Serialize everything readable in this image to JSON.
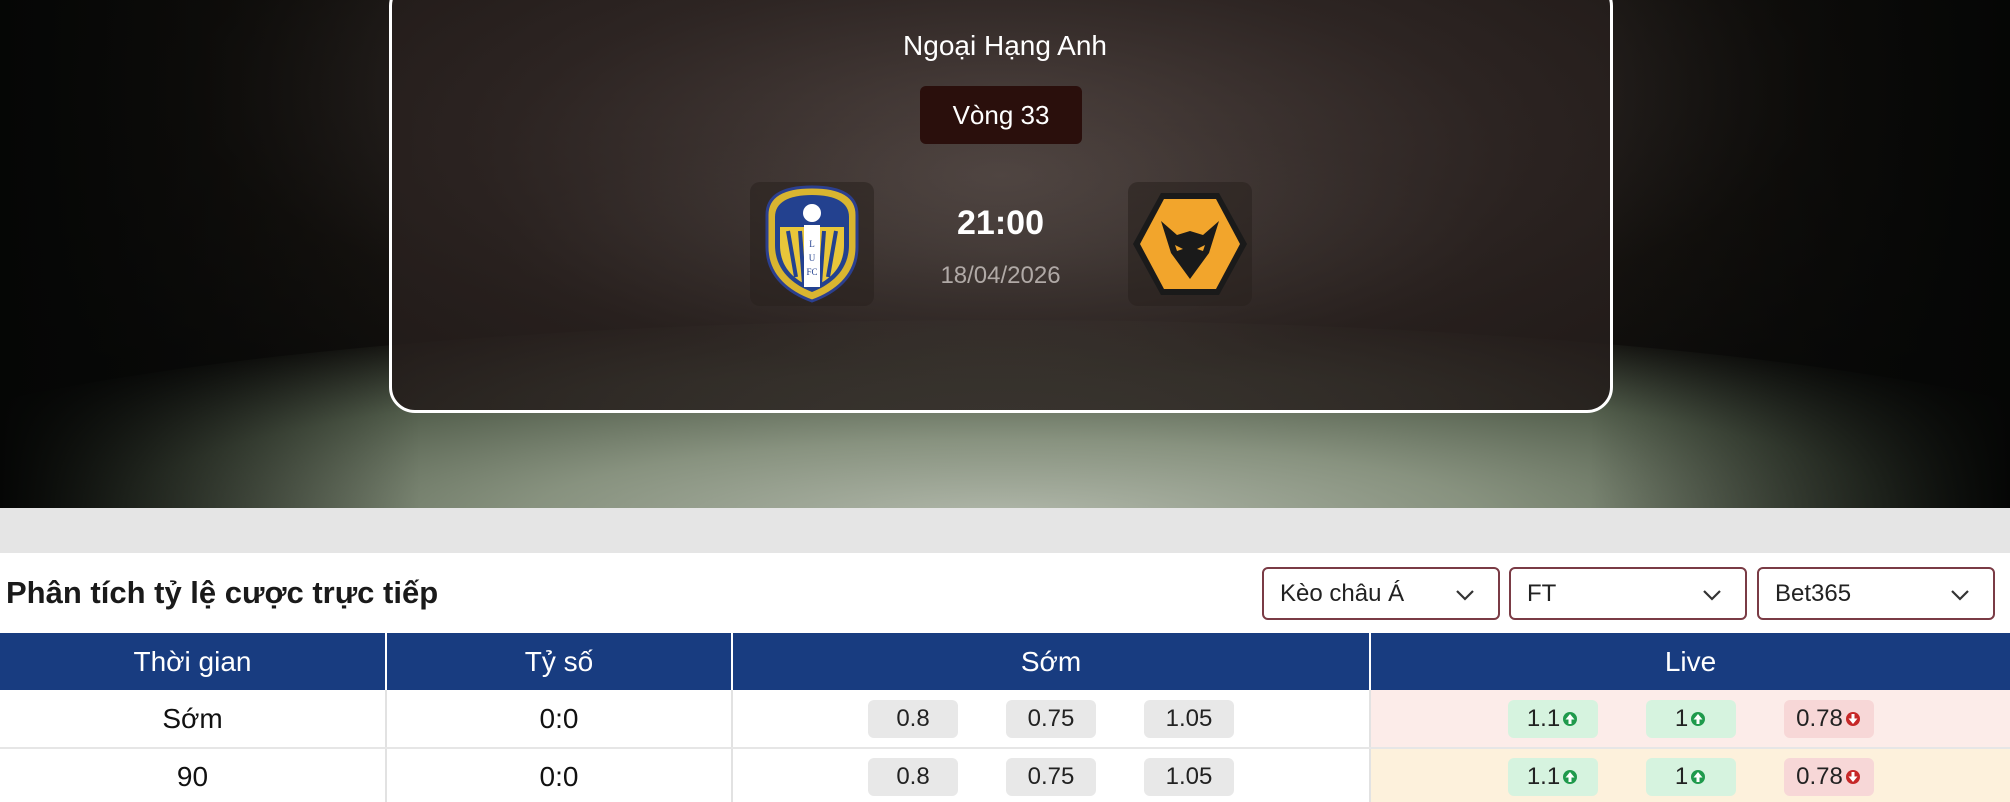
{
  "match": {
    "league": "Ngoại Hạng Anh",
    "round": "Vòng 33",
    "kickoff_time": "21:00",
    "date": "18/04/2026",
    "home_logo_icon": "leeds-united-crest-icon",
    "away_logo_icon": "wolves-crest-icon"
  },
  "odds_panel": {
    "title": "Phân tích tỷ lệ cược trực tiếp",
    "filters": {
      "market": "Kèo châu Á",
      "period": "FT",
      "bookmaker": "Bet365"
    },
    "columns": [
      "Thời gian",
      "Tỷ số",
      "Sớm",
      "Live"
    ],
    "rows": [
      {
        "time": "Sớm",
        "score": "0:0",
        "early": [
          "0.8",
          "0.75",
          "1.05"
        ],
        "live": [
          {
            "value": "1.1",
            "trend": "up"
          },
          {
            "value": "1",
            "trend": "up"
          },
          {
            "value": "0.78",
            "trend": "down"
          }
        ]
      },
      {
        "time": "90",
        "score": "0:0",
        "early": [
          "0.8",
          "0.75",
          "1.05"
        ],
        "live": [
          {
            "value": "1.1",
            "trend": "up"
          },
          {
            "value": "1",
            "trend": "up"
          },
          {
            "value": "0.78",
            "trend": "down"
          }
        ]
      }
    ]
  },
  "colors": {
    "header_blue": "#183c80",
    "round_badge": "#2a0f0c",
    "select_border": "#7a3b45",
    "up_bg": "#d6f3df",
    "down_bg": "#f7d7d7",
    "up_arrow": "#1f9a4c",
    "down_arrow": "#c62828"
  }
}
